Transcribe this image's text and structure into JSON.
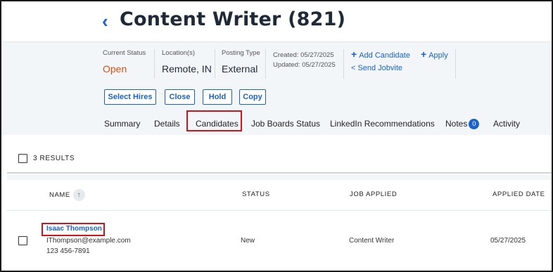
{
  "header": {
    "back_icon": "chevron-left-icon",
    "title": "Content Writer (821)"
  },
  "meta": {
    "status_label": "Current Status",
    "status_value": "Open",
    "location_label": "Location(s)",
    "location_value": "Remote, IN",
    "posting_label": "Posting Type",
    "posting_value": "External",
    "created": "Created: 05/27/2025",
    "updated": "Updated: 05/27/2025"
  },
  "actions": {
    "add_candidate": "Add Candidate",
    "apply": "Apply",
    "send_jobvite": "Send Jobvite"
  },
  "buttons": {
    "select_hires": "Select Hires",
    "close": "Close",
    "hold": "Hold",
    "copy": "Copy"
  },
  "tabs": {
    "summary": "Summary",
    "details": "Details",
    "candidates": "Candidates",
    "job_boards_status": "Job Boards Status",
    "linkedin": "LinkedIn Recommendations",
    "notes": "Notes",
    "notes_count": "0",
    "activity": "Activity"
  },
  "results": {
    "count_text": "3 RESULTS"
  },
  "table": {
    "headers": {
      "name": "NAME",
      "status": "STATUS",
      "job_applied": "JOB APPLIED",
      "applied_date": "APPLIED DATE"
    },
    "rows": [
      {
        "name": "Isaac Thompson",
        "email": "IThompson@example.com",
        "phone": "123 456-7891",
        "status": "New",
        "job_applied": "Content Writer",
        "applied_date": "05/27/2025"
      }
    ]
  },
  "colors": {
    "accent": "#1a62c9",
    "status_open": "#d9500f",
    "highlight": "#d0141a"
  }
}
